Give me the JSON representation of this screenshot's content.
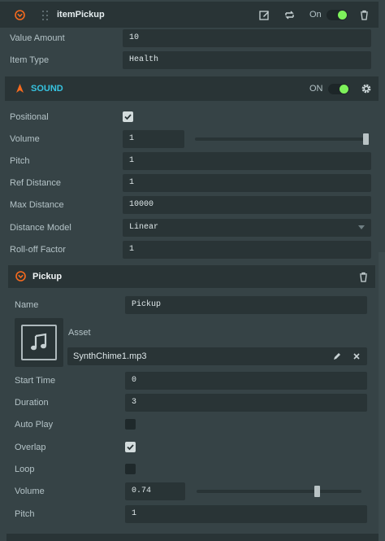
{
  "script_header": {
    "title": "itemPickup",
    "on_label": "On",
    "icons": [
      "chevron-down-icon",
      "grip-icon",
      "edit-icon",
      "swap-icon",
      "trash-icon"
    ]
  },
  "script_attributes": [
    {
      "label": "Value Amount",
      "value": "10"
    },
    {
      "label": "Item Type",
      "value": "Health"
    }
  ],
  "sound": {
    "title": "SOUND",
    "on_label": "ON",
    "positional_label": "Positional",
    "positional_checked": true,
    "volume_label": "Volume",
    "volume_value": "1",
    "volume_fraction": 1.0,
    "pitch_label": "Pitch",
    "pitch_value": "1",
    "ref_distance_label": "Ref Distance",
    "ref_distance_value": "1",
    "max_distance_label": "Max Distance",
    "max_distance_value": "10000",
    "distance_model_label": "Distance Model",
    "distance_model_value": "Linear",
    "rolloff_label": "Roll-off Factor",
    "rolloff_value": "1",
    "accent_color": "#36c3e0",
    "icon_color": "#f56a1e"
  },
  "slot": {
    "title": "Pickup",
    "name_label": "Name",
    "name_value": "Pickup",
    "asset_label": "Asset",
    "asset_file": "SynthChime1.mp3",
    "start_time_label": "Start Time",
    "start_time_value": "0",
    "duration_label": "Duration",
    "duration_value": "3",
    "autoplay_label": "Auto Play",
    "autoplay_checked": false,
    "overlap_label": "Overlap",
    "overlap_checked": true,
    "loop_label": "Loop",
    "loop_checked": false,
    "volume_label": "Volume",
    "volume_value": "0.74",
    "volume_fraction": 0.74,
    "pitch_label": "Pitch",
    "pitch_value": "1"
  }
}
